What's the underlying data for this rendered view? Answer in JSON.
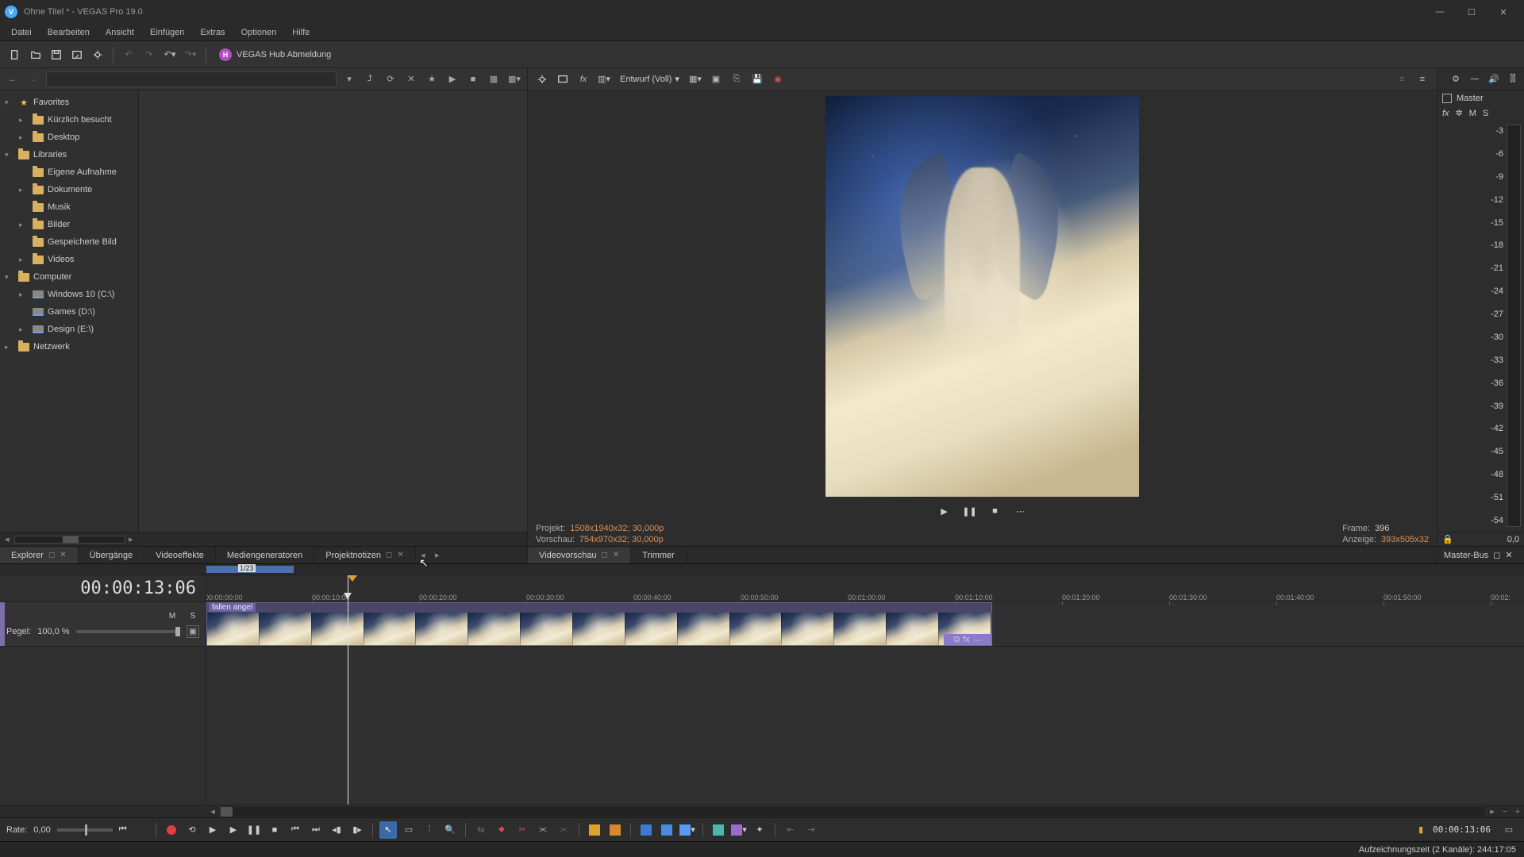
{
  "app": {
    "title": "Ohne Titel * - VEGAS Pro 19.0",
    "logo_letter": "V"
  },
  "menu": [
    "Datei",
    "Bearbeiten",
    "Ansicht",
    "Einfügen",
    "Extras",
    "Optionen",
    "Hilfe"
  ],
  "hub": {
    "letter": "H",
    "label": "VEGAS Hub Abmeldung"
  },
  "explorer_tree": [
    {
      "label": "Favorites",
      "icon": "star",
      "indent": 0,
      "twisty": "▾"
    },
    {
      "label": "Kürzlich besucht",
      "icon": "folder",
      "indent": 1,
      "twisty": "▸"
    },
    {
      "label": "Desktop",
      "icon": "folder",
      "indent": 1,
      "twisty": "▸"
    },
    {
      "label": "Libraries",
      "icon": "folder",
      "indent": 0,
      "twisty": "▾"
    },
    {
      "label": "Eigene Aufnahme",
      "icon": "folder",
      "indent": 1,
      "twisty": ""
    },
    {
      "label": "Dokumente",
      "icon": "folder",
      "indent": 1,
      "twisty": "▸"
    },
    {
      "label": "Musik",
      "icon": "folder",
      "indent": 1,
      "twisty": ""
    },
    {
      "label": "Bilder",
      "icon": "folder",
      "indent": 1,
      "twisty": "▸"
    },
    {
      "label": "Gespeicherte Bild",
      "icon": "folder",
      "indent": 1,
      "twisty": ""
    },
    {
      "label": "Videos",
      "icon": "folder",
      "indent": 1,
      "twisty": "▸"
    },
    {
      "label": "Computer",
      "icon": "folder",
      "indent": 0,
      "twisty": "▾"
    },
    {
      "label": "Windows 10 (C:\\)",
      "icon": "disk",
      "indent": 1,
      "twisty": "▸"
    },
    {
      "label": "Games (D:\\)",
      "icon": "disk",
      "indent": 1,
      "twisty": ""
    },
    {
      "label": "Design (E:\\)",
      "icon": "disk",
      "indent": 1,
      "twisty": "▸"
    },
    {
      "label": "Netzwerk",
      "icon": "folder",
      "indent": 0,
      "twisty": "▸"
    }
  ],
  "left_tabs": [
    {
      "label": "Explorer",
      "active": true,
      "closable": true
    },
    {
      "label": "Übergänge",
      "active": false,
      "closable": false
    },
    {
      "label": "Videoeffekte",
      "active": false,
      "closable": false
    },
    {
      "label": "Mediengeneratoren",
      "active": false,
      "closable": false
    },
    {
      "label": "Projektnotizen",
      "active": false,
      "closable": true
    }
  ],
  "preview_toolbar": {
    "quality_label": "Entwurf (Voll)"
  },
  "preview_info": {
    "projekt_label": "Projekt:",
    "projekt_value": "1508x1940x32; 30,000p",
    "vorschau_label": "Vorschau:",
    "vorschau_value": "754x970x32; 30,000p",
    "frame_label": "Frame:",
    "frame_value": "396",
    "anzeige_label": "Anzeige:",
    "anzeige_value": "393x505x32"
  },
  "right_tabs": [
    {
      "label": "Videovorschau",
      "active": true,
      "closable": true
    },
    {
      "label": "Trimmer",
      "active": false,
      "closable": false
    }
  ],
  "master": {
    "title": "Master",
    "buttons": {
      "fx": "fx",
      "mute": "M",
      "solo": "S"
    },
    "scale": [
      "-3",
      "-6",
      "-9",
      "-12",
      "-15",
      "-18",
      "-21",
      "-24",
      "-27",
      "-30",
      "-33",
      "-36",
      "-39",
      "-42",
      "-45",
      "-48",
      "-51",
      "-54"
    ],
    "value": "0,0",
    "tab": "Master-Bus"
  },
  "timeline": {
    "timecode": "00:00:13:06",
    "overview_label": "1/23",
    "ruler": [
      "00:00:00:00",
      "00:00:10:00",
      "00:00:20:00",
      "00:00:30:00",
      "00:00:40:00",
      "00:00:50:00",
      "00:01:00:00",
      "00:01:10:00",
      "00:01:20:00",
      "00:01:30:00",
      "00:01:40:00",
      "00:01:50:00",
      "00:02:"
    ],
    "track": {
      "mute": "M",
      "solo": "S",
      "level_label": "Pegel:",
      "level_value": "100,0 %"
    },
    "clip": {
      "name": "fallen angel",
      "fx_label": "fx",
      "crop_icon": "⧉",
      "more": "⋯"
    }
  },
  "transport": {
    "rate_label": "Rate:",
    "rate_value": "0,00",
    "timecode": "00:00:13:06",
    "colors": {
      "orange": "#e0a030",
      "orange2": "#d88830",
      "blue1": "#3a7ad0",
      "blue2": "#4a8ae0",
      "blue3": "#5a9af0",
      "teal": "#4ab8b0",
      "purple": "#9a6ad0"
    }
  },
  "status": {
    "text": "Aufzeichnungszeit (2 Kanäle): 244:17:05"
  }
}
